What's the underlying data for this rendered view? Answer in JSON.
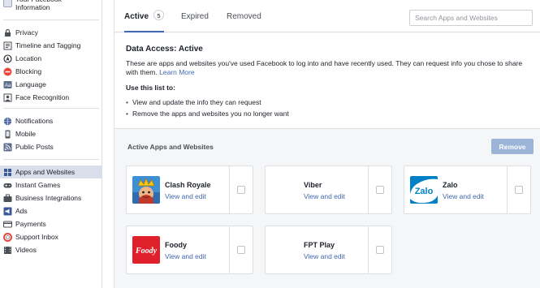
{
  "sidebar": {
    "header_label": "Your Facebook Information",
    "group1": [
      {
        "label": "Privacy",
        "icon": "lock-icon"
      },
      {
        "label": "Timeline and Tagging",
        "icon": "timeline-icon"
      },
      {
        "label": "Location",
        "icon": "location-icon"
      },
      {
        "label": "Blocking",
        "icon": "blocking-icon"
      },
      {
        "label": "Language",
        "icon": "language-icon"
      },
      {
        "label": "Face Recognition",
        "icon": "face-recognition-icon"
      }
    ],
    "group2": [
      {
        "label": "Notifications",
        "icon": "globe-icon"
      },
      {
        "label": "Mobile",
        "icon": "mobile-icon"
      },
      {
        "label": "Public Posts",
        "icon": "rss-icon"
      }
    ],
    "group3": [
      {
        "label": "Apps and Websites",
        "icon": "apps-icon",
        "active": true
      },
      {
        "label": "Instant Games",
        "icon": "games-icon"
      },
      {
        "label": "Business Integrations",
        "icon": "business-icon"
      },
      {
        "label": "Ads",
        "icon": "ads-icon"
      },
      {
        "label": "Payments",
        "icon": "payments-icon"
      },
      {
        "label": "Support Inbox",
        "icon": "lifebuoy-icon"
      },
      {
        "label": "Videos",
        "icon": "video-icon"
      }
    ]
  },
  "tabs": {
    "active_label": "Active",
    "active_count": "5",
    "expired_label": "Expired",
    "removed_label": "Removed"
  },
  "search": {
    "placeholder": "Search Apps and Websites"
  },
  "info": {
    "title": "Data Access: Active",
    "description": "These are apps and websites you've used Facebook to log into and have recently used. They can request info you chose to share with them.",
    "learn_more": "Learn More",
    "list_heading": "Use this list to:",
    "bullets": [
      "View and update the info they can request",
      "Remove the apps and websites you no longer want"
    ]
  },
  "apps_section": {
    "label": "Active Apps and Websites",
    "remove_label": "Remove"
  },
  "apps": [
    {
      "name": "Clash Royale",
      "link": "View and edit",
      "logo": "clash-royale-logo"
    },
    {
      "name": "Viber",
      "link": "View and edit",
      "logo": "none"
    },
    {
      "name": "Zalo",
      "link": "View and edit",
      "logo": "zalo-logo",
      "logo_text": "Zalo"
    },
    {
      "name": "Foody",
      "link": "View and edit",
      "logo": "foody-logo",
      "logo_text": "Foody"
    },
    {
      "name": "FPT Play",
      "link": "View and edit",
      "logo": "none"
    }
  ],
  "colors": {
    "accent": "#4267b2",
    "remove_disabled": "#9cb4d8",
    "zalo": "#0180c7",
    "foody": "#e0212b"
  }
}
